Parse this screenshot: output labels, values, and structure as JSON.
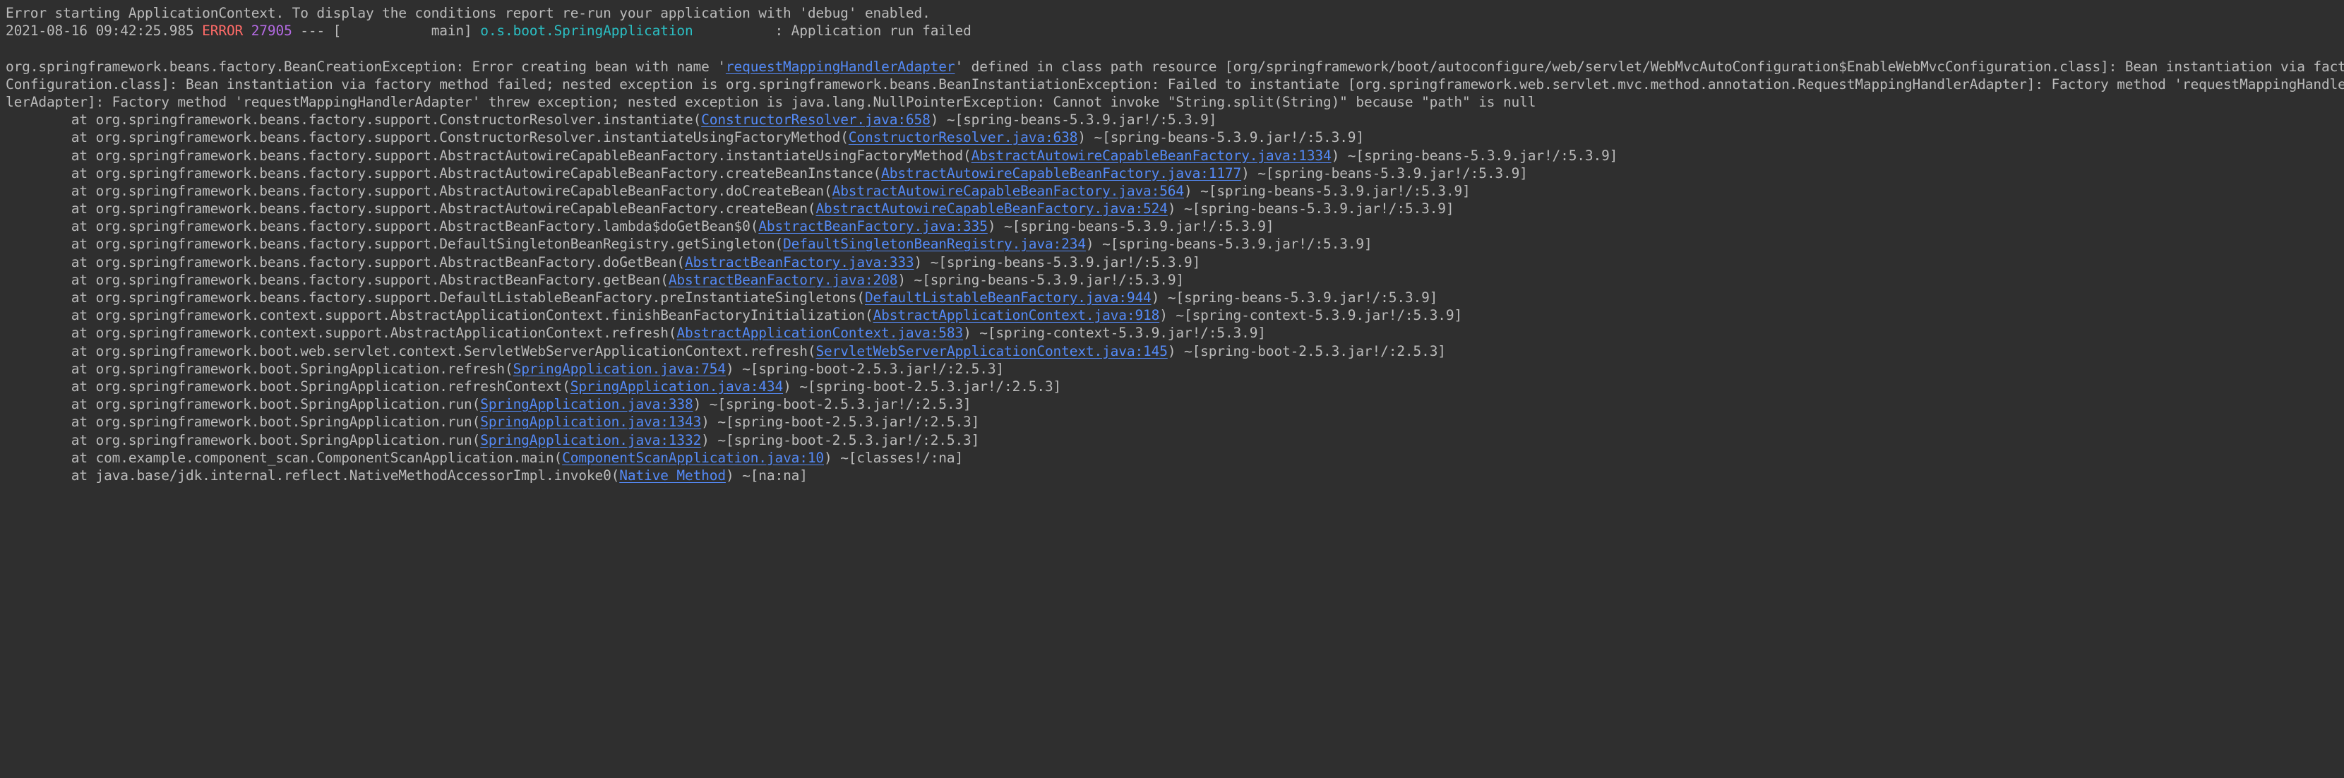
{
  "console": {
    "title": "Spring Boot application console output",
    "colors": {
      "background": "#2f2f2f",
      "text": "#bbbbbb",
      "error": "#ff6b68",
      "pid": "#b36ae2",
      "logger": "#2bbfc4",
      "link": "#548af7"
    },
    "lines": [
      {
        "name": "error-context-line",
        "segments": [
          {
            "text": "Error starting ApplicationContext. To display the conditions report re-run your application with 'debug' enabled.",
            "style": "plain",
            "link": false
          }
        ]
      },
      {
        "name": "log-timestamp-line",
        "segments": [
          {
            "text": "2021-08-16 09:42:25.985 ",
            "style": "plain",
            "link": false
          },
          {
            "text": "ERROR",
            "style": "error",
            "link": false
          },
          {
            "text": " ",
            "style": "plain",
            "link": false
          },
          {
            "text": "27905",
            "style": "pid",
            "link": false
          },
          {
            "text": " --- [           main] ",
            "style": "plain",
            "link": false
          },
          {
            "text": "o.s.boot.SpringApplication",
            "style": "logger",
            "link": false
          },
          {
            "text": "          : Application run failed",
            "style": "plain",
            "link": false
          }
        ]
      },
      {
        "name": "blank-line",
        "segments": [
          {
            "text": "",
            "style": "plain",
            "link": false
          }
        ]
      },
      {
        "name": "exception-header-line",
        "segments": [
          {
            "text": "org.springframework.beans.factory.BeanCreationException: Error creating bean with name '",
            "style": "plain",
            "link": false
          },
          {
            "text": "requestMappingHandlerAdapter",
            "style": "link",
            "link": true
          },
          {
            "text": "' defined in class path resource [org/springframework/boot/autoconfigure/web/servlet/WebMvcAutoConfiguration$EnableWebMvcConfiguration.class]: Bean instantiation via factory method failed; nested exception is org.springframework.beans.BeanInstantiationException: Failed to instantiate [org.springframework.web.servlet.mvc.method.annotation.RequestMappingHandlerAdapter]: Factory method 'requestMappingHandlerAdapter' threw exception; nested exception is java.lang.NullPointerException: Cannot invoke \"String.split(String)\" because \"path\" is null",
            "style": "plain",
            "link": false
          }
        ]
      },
      {
        "name": "exception-wrap-line-1",
        "segments": [
          {
            "text": "Configuration.class]: Bean instantiation via factory method failed; nested exception is org.springframework.beans.BeanInstantiationException: Failed to instantiate [org.springframework.web.servlet.mvc.method.annotation.RequestMappingHandlerAdapter]: Factory method 'requestMappingHandlerAdapter' threw exception; nested exception is java.lang.NullPointerException",
            "style": "plain",
            "link": false
          }
        ]
      },
      {
        "name": "exception-wrap-line-2",
        "segments": [
          {
            "text": "lerAdapter]: Factory method 'requestMappingHandlerAdapter' threw exception; nested exception is java.lang.NullPointerException: Cannot invoke \"String.split(String)\" because \"path\" is null",
            "style": "plain",
            "link": false
          }
        ]
      },
      {
        "name": "stack-frame-line",
        "segments": [
          {
            "text": "\tat org.springframework.beans.factory.support.ConstructorResolver.instantiate(",
            "style": "plain",
            "link": false
          },
          {
            "text": "ConstructorResolver.java:658",
            "style": "link",
            "link": true
          },
          {
            "text": ") ~[spring-beans-5.3.9.jar!/:5.3.9]",
            "style": "plain",
            "link": false
          }
        ]
      },
      {
        "name": "stack-frame-line",
        "segments": [
          {
            "text": "\tat org.springframework.beans.factory.support.ConstructorResolver.instantiateUsingFactoryMethod(",
            "style": "plain",
            "link": false
          },
          {
            "text": "ConstructorResolver.java:638",
            "style": "link",
            "link": true
          },
          {
            "text": ") ~[spring-beans-5.3.9.jar!/:5.3.9]",
            "style": "plain",
            "link": false
          }
        ]
      },
      {
        "name": "stack-frame-line",
        "segments": [
          {
            "text": "\tat org.springframework.beans.factory.support.AbstractAutowireCapableBeanFactory.instantiateUsingFactoryMethod(",
            "style": "plain",
            "link": false
          },
          {
            "text": "AbstractAutowireCapableBeanFactory.java:1334",
            "style": "link",
            "link": true
          },
          {
            "text": ") ~[spring-beans-5.3.9.jar!/:5.3.9]",
            "style": "plain",
            "link": false
          }
        ]
      },
      {
        "name": "stack-frame-line",
        "segments": [
          {
            "text": "\tat org.springframework.beans.factory.support.AbstractAutowireCapableBeanFactory.createBeanInstance(",
            "style": "plain",
            "link": false
          },
          {
            "text": "AbstractAutowireCapableBeanFactory.java:1177",
            "style": "link",
            "link": true
          },
          {
            "text": ") ~[spring-beans-5.3.9.jar!/:5.3.9]",
            "style": "plain",
            "link": false
          }
        ]
      },
      {
        "name": "stack-frame-line",
        "segments": [
          {
            "text": "\tat org.springframework.beans.factory.support.AbstractAutowireCapableBeanFactory.doCreateBean(",
            "style": "plain",
            "link": false
          },
          {
            "text": "AbstractAutowireCapableBeanFactory.java:564",
            "style": "link",
            "link": true
          },
          {
            "text": ") ~[spring-beans-5.3.9.jar!/:5.3.9]",
            "style": "plain",
            "link": false
          }
        ]
      },
      {
        "name": "stack-frame-line",
        "segments": [
          {
            "text": "\tat org.springframework.beans.factory.support.AbstractAutowireCapableBeanFactory.createBean(",
            "style": "plain",
            "link": false
          },
          {
            "text": "AbstractAutowireCapableBeanFactory.java:524",
            "style": "link",
            "link": true
          },
          {
            "text": ") ~[spring-beans-5.3.9.jar!/:5.3.9]",
            "style": "plain",
            "link": false
          }
        ]
      },
      {
        "name": "stack-frame-line",
        "segments": [
          {
            "text": "\tat org.springframework.beans.factory.support.AbstractBeanFactory.lambda$doGetBean$0(",
            "style": "plain",
            "link": false
          },
          {
            "text": "AbstractBeanFactory.java:335",
            "style": "link",
            "link": true
          },
          {
            "text": ") ~[spring-beans-5.3.9.jar!/:5.3.9]",
            "style": "plain",
            "link": false
          }
        ]
      },
      {
        "name": "stack-frame-line",
        "segments": [
          {
            "text": "\tat org.springframework.beans.factory.support.DefaultSingletonBeanRegistry.getSingleton(",
            "style": "plain",
            "link": false
          },
          {
            "text": "DefaultSingletonBeanRegistry.java:234",
            "style": "link",
            "link": true
          },
          {
            "text": ") ~[spring-beans-5.3.9.jar!/:5.3.9]",
            "style": "plain",
            "link": false
          }
        ]
      },
      {
        "name": "stack-frame-line",
        "segments": [
          {
            "text": "\tat org.springframework.beans.factory.support.AbstractBeanFactory.doGetBean(",
            "style": "plain",
            "link": false
          },
          {
            "text": "AbstractBeanFactory.java:333",
            "style": "link",
            "link": true
          },
          {
            "text": ") ~[spring-beans-5.3.9.jar!/:5.3.9]",
            "style": "plain",
            "link": false
          }
        ]
      },
      {
        "name": "stack-frame-line",
        "segments": [
          {
            "text": "\tat org.springframework.beans.factory.support.AbstractBeanFactory.getBean(",
            "style": "plain",
            "link": false
          },
          {
            "text": "AbstractBeanFactory.java:208",
            "style": "link",
            "link": true
          },
          {
            "text": ") ~[spring-beans-5.3.9.jar!/:5.3.9]",
            "style": "plain",
            "link": false
          }
        ]
      },
      {
        "name": "stack-frame-line",
        "segments": [
          {
            "text": "\tat org.springframework.beans.factory.support.DefaultListableBeanFactory.preInstantiateSingletons(",
            "style": "plain",
            "link": false
          },
          {
            "text": "DefaultListableBeanFactory.java:944",
            "style": "link",
            "link": true
          },
          {
            "text": ") ~[spring-beans-5.3.9.jar!/:5.3.9]",
            "style": "plain",
            "link": false
          }
        ]
      },
      {
        "name": "stack-frame-line",
        "segments": [
          {
            "text": "\tat org.springframework.context.support.AbstractApplicationContext.finishBeanFactoryInitialization(",
            "style": "plain",
            "link": false
          },
          {
            "text": "AbstractApplicationContext.java:918",
            "style": "link",
            "link": true
          },
          {
            "text": ") ~[spring-context-5.3.9.jar!/:5.3.9]",
            "style": "plain",
            "link": false
          }
        ]
      },
      {
        "name": "stack-frame-line",
        "segments": [
          {
            "text": "\tat org.springframework.context.support.AbstractApplicationContext.refresh(",
            "style": "plain",
            "link": false
          },
          {
            "text": "AbstractApplicationContext.java:583",
            "style": "link",
            "link": true
          },
          {
            "text": ") ~[spring-context-5.3.9.jar!/:5.3.9]",
            "style": "plain",
            "link": false
          }
        ]
      },
      {
        "name": "stack-frame-line",
        "segments": [
          {
            "text": "\tat org.springframework.boot.web.servlet.context.ServletWebServerApplicationContext.refresh(",
            "style": "plain",
            "link": false
          },
          {
            "text": "ServletWebServerApplicationContext.java:145",
            "style": "link",
            "link": true
          },
          {
            "text": ") ~[spring-boot-2.5.3.jar!/:2.5.3]",
            "style": "plain",
            "link": false
          }
        ]
      },
      {
        "name": "stack-frame-line",
        "segments": [
          {
            "text": "\tat org.springframework.boot.SpringApplication.refresh(",
            "style": "plain",
            "link": false
          },
          {
            "text": "SpringApplication.java:754",
            "style": "link",
            "link": true
          },
          {
            "text": ") ~[spring-boot-2.5.3.jar!/:2.5.3]",
            "style": "plain",
            "link": false
          }
        ]
      },
      {
        "name": "stack-frame-line",
        "segments": [
          {
            "text": "\tat org.springframework.boot.SpringApplication.refreshContext(",
            "style": "plain",
            "link": false
          },
          {
            "text": "SpringApplication.java:434",
            "style": "link",
            "link": true
          },
          {
            "text": ") ~[spring-boot-2.5.3.jar!/:2.5.3]",
            "style": "plain",
            "link": false
          }
        ]
      },
      {
        "name": "stack-frame-line",
        "segments": [
          {
            "text": "\tat org.springframework.boot.SpringApplication.run(",
            "style": "plain",
            "link": false
          },
          {
            "text": "SpringApplication.java:338",
            "style": "link",
            "link": true
          },
          {
            "text": ") ~[spring-boot-2.5.3.jar!/:2.5.3]",
            "style": "plain",
            "link": false
          }
        ]
      },
      {
        "name": "stack-frame-line",
        "segments": [
          {
            "text": "\tat org.springframework.boot.SpringApplication.run(",
            "style": "plain",
            "link": false
          },
          {
            "text": "SpringApplication.java:1343",
            "style": "link",
            "link": true
          },
          {
            "text": ") ~[spring-boot-2.5.3.jar!/:2.5.3]",
            "style": "plain",
            "link": false
          }
        ]
      },
      {
        "name": "stack-frame-line",
        "segments": [
          {
            "text": "\tat org.springframework.boot.SpringApplication.run(",
            "style": "plain",
            "link": false
          },
          {
            "text": "SpringApplication.java:1332",
            "style": "link",
            "link": true
          },
          {
            "text": ") ~[spring-boot-2.5.3.jar!/:2.5.3]",
            "style": "plain",
            "link": false
          }
        ]
      },
      {
        "name": "stack-frame-line",
        "segments": [
          {
            "text": "\tat com.example.component_scan.ComponentScanApplication.main(",
            "style": "plain",
            "link": false
          },
          {
            "text": "ComponentScanApplication.java:10",
            "style": "link",
            "link": true
          },
          {
            "text": ") ~[classes!/:na]",
            "style": "plain",
            "link": false
          }
        ]
      },
      {
        "name": "stack-frame-line",
        "segments": [
          {
            "text": "\tat java.base/jdk.internal.reflect.NativeMethodAccessorImpl.invoke0(",
            "style": "plain",
            "link": false
          },
          {
            "text": "Native Method",
            "style": "link",
            "link": true
          },
          {
            "text": ") ~[na:na]",
            "style": "plain",
            "link": false
          }
        ]
      }
    ]
  }
}
